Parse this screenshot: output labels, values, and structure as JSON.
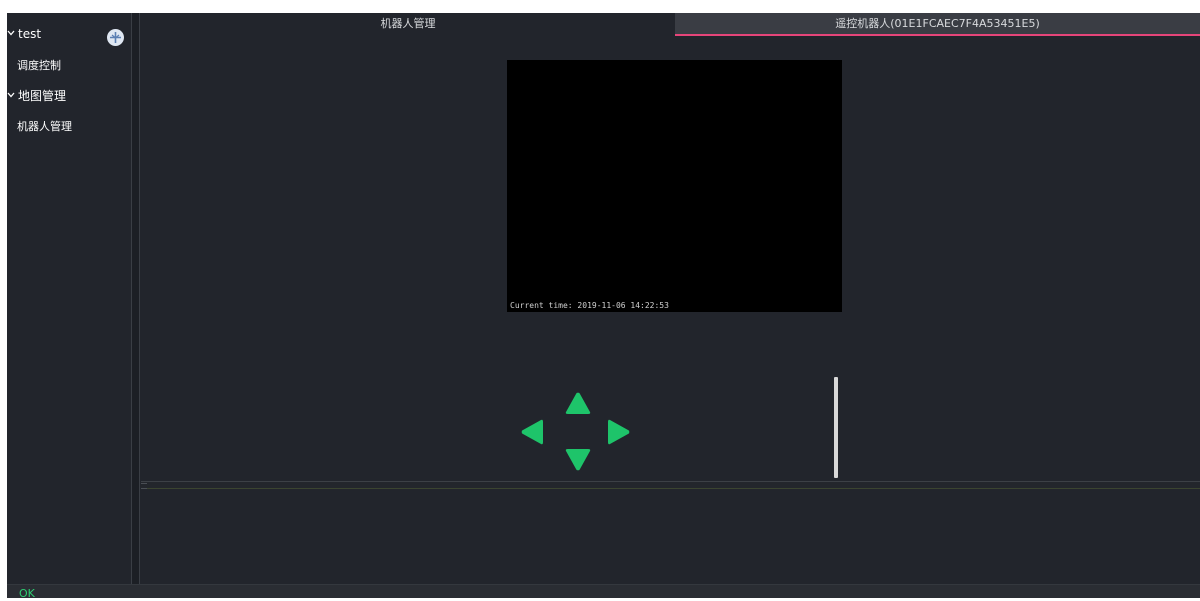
{
  "sidebar": {
    "items": [
      {
        "label": "test",
        "expanded": true,
        "icon": "chevron-down-icon"
      },
      {
        "label": "调度控制"
      },
      {
        "label": "地图管理",
        "expanded": true,
        "icon": "chevron-down-icon"
      },
      {
        "label": "机器人管理"
      }
    ],
    "add_icon": "add-robot-icon"
  },
  "tabs": [
    {
      "label": "机器人管理",
      "active": false
    },
    {
      "label": "遥控机器人(01E1FCAEC7F4A53451E5)",
      "active": true
    }
  ],
  "video": {
    "timestamp": "Current time: 2019-11-06 14:22:53"
  },
  "controls": {
    "arrows": [
      "arrow-up-icon",
      "arrow-left-icon",
      "arrow-right-icon",
      "arrow-down-icon"
    ],
    "arrow_color": "#1ec46a",
    "accent_color": "#e6457a"
  },
  "status": {
    "text": "OK"
  }
}
